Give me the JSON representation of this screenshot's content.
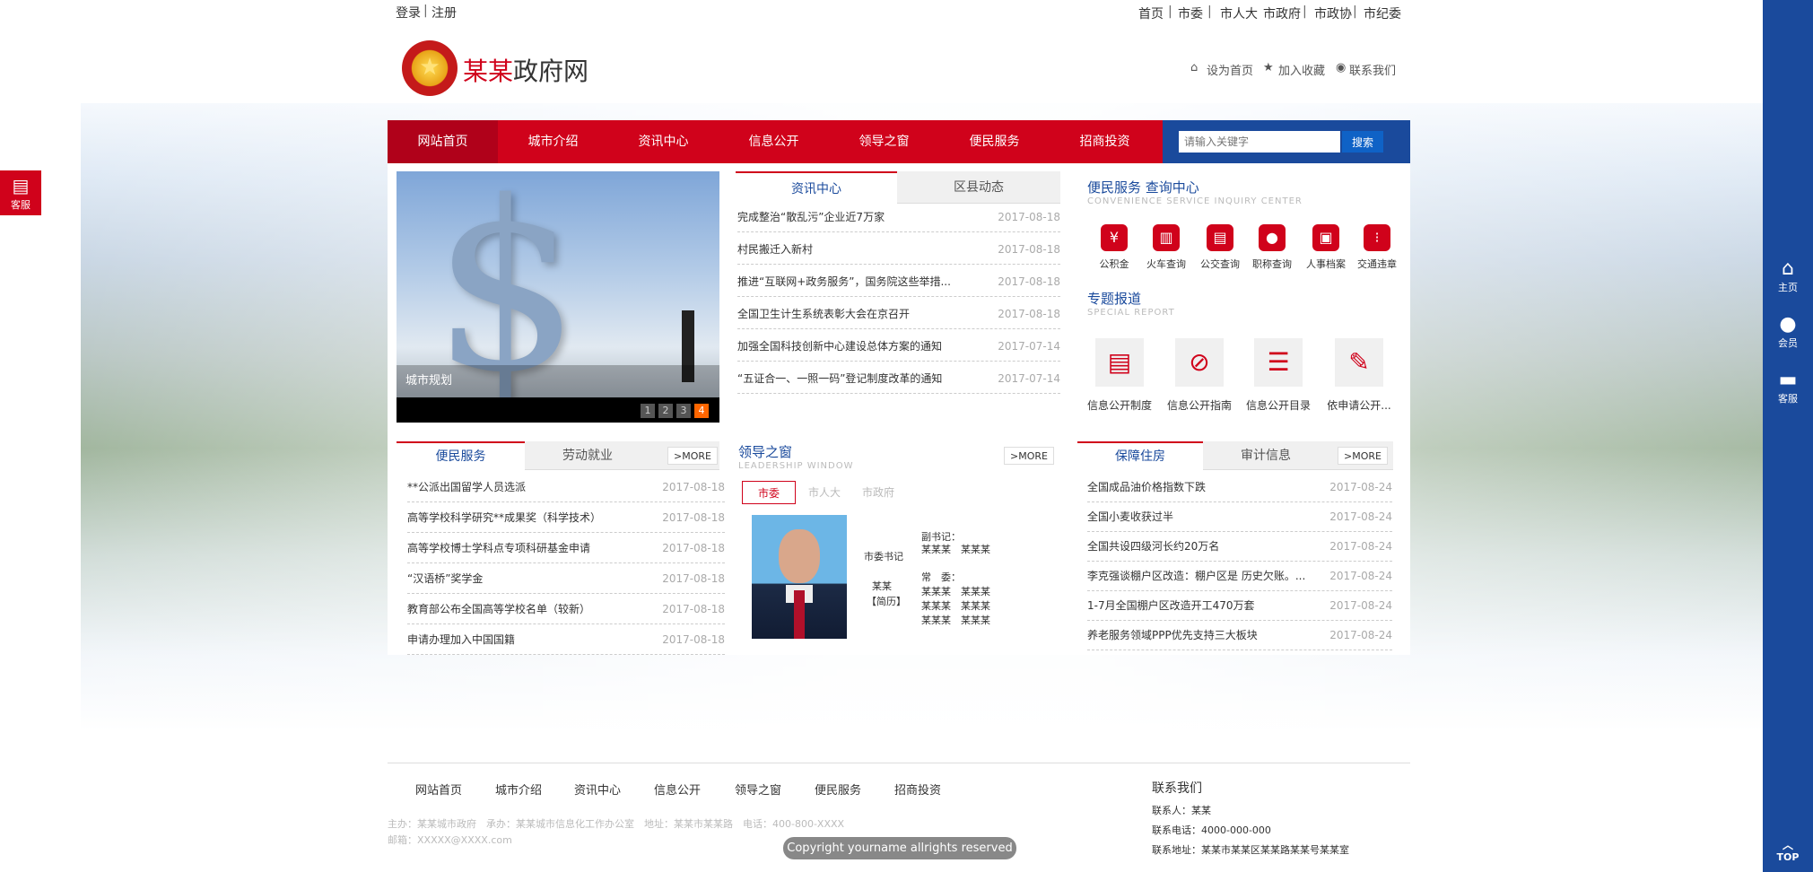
{
  "topbar": {
    "login": "登录",
    "register": "注册",
    "links": [
      "首页",
      "市委",
      "市人大",
      "市政府",
      "市政协",
      "市纪委"
    ]
  },
  "header": {
    "logo_red": "某某",
    "logo_rest": "政府网",
    "set_home": "设为首页",
    "favorite": "加入收藏",
    "contact": "联系我们"
  },
  "nav": {
    "items": [
      "网站首页",
      "城市介绍",
      "资讯中心",
      "信息公开",
      "领导之窗",
      "便民服务",
      "招商投资"
    ],
    "search_placeholder": "请输入关键字",
    "search_button": "搜索"
  },
  "slider": {
    "caption": "城市规划",
    "pages": [
      "1",
      "2",
      "3",
      "4"
    ]
  },
  "news": {
    "tabs": [
      "资讯中心",
      "区县动态"
    ],
    "items": [
      {
        "title": "完成整治“散乱污”企业近7万家",
        "date": "2017-08-18"
      },
      {
        "title": "村民搬迁入新村",
        "date": "2017-08-18"
      },
      {
        "title": "推进“互联网+政务服务”，国务院这些举措...",
        "date": "2017-08-18"
      },
      {
        "title": "全国卫生计生系统表彰大会在京召开",
        "date": "2017-08-18"
      },
      {
        "title": "加强全国科技创新中心建设总体方案的通知",
        "date": "2017-07-14"
      },
      {
        "title": "“五证合一、一照一码”登记制度改革的通知",
        "date": "2017-07-14"
      }
    ]
  },
  "services": {
    "title": "便民服务 查询中心",
    "subtitle": "CONVENIENCE SERVICE INQUIRY CENTER",
    "items": [
      "公积金",
      "火车查询",
      "公交查询",
      "职称查询",
      "人事档案",
      "交通违章"
    ],
    "icons": [
      "coin-icon",
      "train-icon",
      "bus-icon",
      "person-icon",
      "briefcase-icon",
      "traffic-light-icon"
    ]
  },
  "special": {
    "title": "专题报道",
    "subtitle": "SPECIAL REPORT",
    "items": [
      "信息公开制度",
      "信息公开指南",
      "信息公开目录",
      "依申请公开..."
    ],
    "icons": [
      "document-search-icon",
      "compass-icon",
      "list-icon",
      "edit-note-icon"
    ]
  },
  "left_list": {
    "tabs": [
      "便民服务",
      "劳动就业"
    ],
    "more": ">MORE",
    "items": [
      {
        "title": "**公派出国留学人员选派",
        "date": "2017-08-18"
      },
      {
        "title": "高等学校科学研究**成果奖（科学技术）",
        "date": "2017-08-18"
      },
      {
        "title": "高等学校博士学科点专项科研基金申请",
        "date": "2017-08-18"
      },
      {
        "title": "“汉语桥”奖学金",
        "date": "2017-08-18"
      },
      {
        "title": "教育部公布全国高等学校名单（较新）",
        "date": "2017-08-18"
      },
      {
        "title": "申请办理加入中国国籍",
        "date": "2017-08-18"
      }
    ]
  },
  "leaders": {
    "title": "领导之窗",
    "subtitle": "LEADERSHIP WINDOW",
    "more": ">MORE",
    "tabs": [
      "市委",
      "市人大",
      "市政府"
    ],
    "role_main": "市委书记",
    "name_main": "某某",
    "resume": "【简历】",
    "deputy_label": "副书记：",
    "deputy_names": "某某某　某某某",
    "member_label": "常　委：",
    "member_rows": [
      "某某某　某某某",
      "某某某　某某某",
      "某某某　某某某"
    ]
  },
  "right_list": {
    "tabs": [
      "保障住房",
      "审计信息"
    ],
    "more": ">MORE",
    "items": [
      {
        "title": "全国成品油价格指数下跌",
        "date": "2017-08-24"
      },
      {
        "title": "全国小麦收获过半",
        "date": "2017-08-24"
      },
      {
        "title": "全国共设四级河长约20万名",
        "date": "2017-08-24"
      },
      {
        "title": "李克强谈棚户区改造：棚户区是 历史欠账。...",
        "date": "2017-08-24"
      },
      {
        "title": "1-7月全国棚户区改造开工470万套",
        "date": "2017-08-24"
      },
      {
        "title": "养老服务领域PPP优先支持三大板块",
        "date": "2017-08-24"
      }
    ]
  },
  "footer": {
    "nav": [
      "网站首页",
      "城市介绍",
      "资讯中心",
      "信息公开",
      "领导之窗",
      "便民服务",
      "招商投资"
    ],
    "info_line1": "主办：某某城市政府　承办：某某城市信息化工作办公室　地址：某某市某某路　电话：400-800-XXXX",
    "info_line2": "邮箱：XXXXX@XXXX.com",
    "contact_title": "联系我们",
    "contact_person": "联系人：某某",
    "contact_phone": "联系电话：4000-000-000",
    "contact_address": "联系地址：某某市某某区某某路某某号某某室",
    "copyright": "Copyright yourname allrights reserved"
  },
  "rightbar": {
    "items": [
      "主页",
      "会员",
      "客服"
    ],
    "top": "TOP"
  },
  "kefu": "客服"
}
